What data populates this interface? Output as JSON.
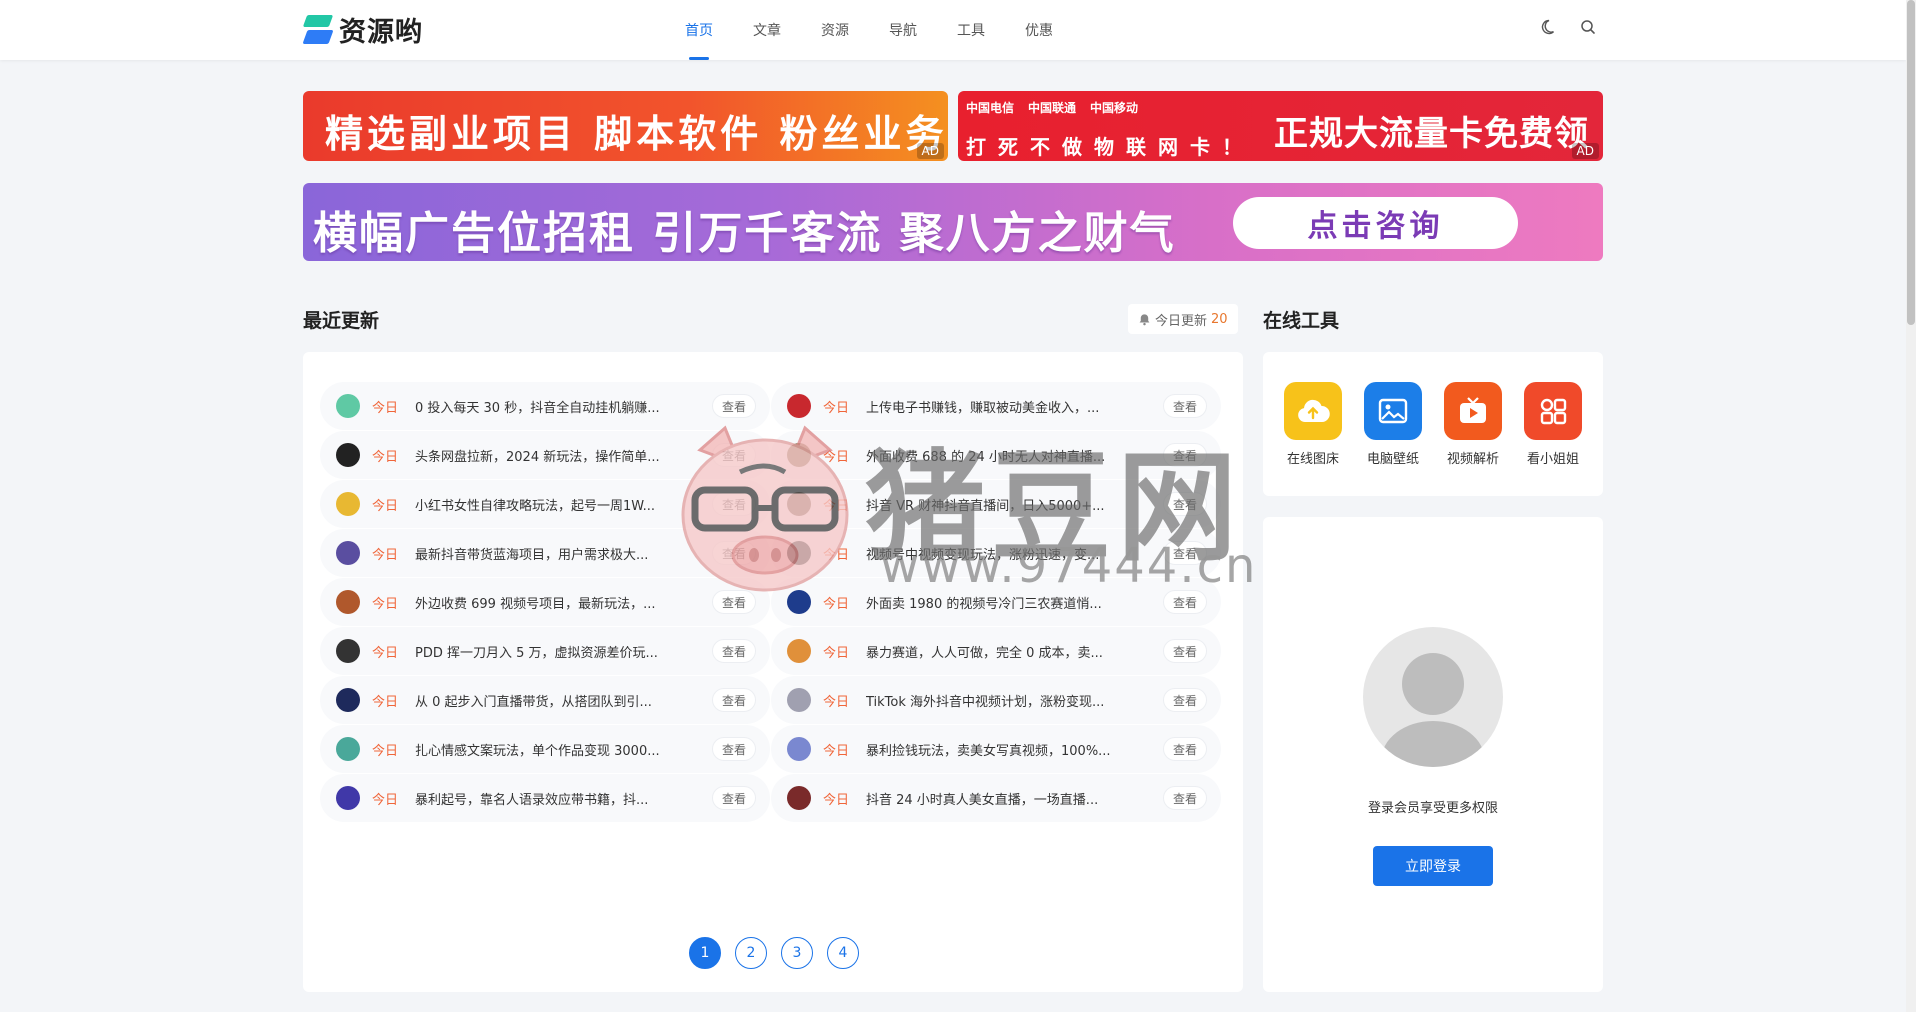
{
  "header": {
    "logo_text": "资源哟",
    "nav": [
      "首页",
      "文章",
      "资源",
      "导航",
      "工具",
      "优惠"
    ],
    "active_nav": 0
  },
  "banners": {
    "b1_text": "精选副业项目 脚本软件 粉丝业务",
    "b2_logos": [
      "中国电信",
      "中国联通",
      "中国移动"
    ],
    "b2_sub": "打死不做物联网卡！",
    "b2_text": "正规大流量卡免费领",
    "ad_tag": "AD",
    "b3_text": "横幅广告位招租 引万千客流 聚八方之财气",
    "b3_cta": "点击咨询"
  },
  "recent": {
    "title": "最近更新",
    "today_label": "今日更新",
    "today_count": "20",
    "tag": "今日",
    "view_label": "查看",
    "left": [
      "0 投入每天 30 秒，抖音全自动挂机躺赚...",
      "头条网盘拉新，2024 新玩法，操作简单...",
      "小红书女性自律攻略玩法，起号一周1W...",
      "最新抖音带货蓝海项目，用户需求极大...",
      "外边收费 699 视频号项目，最新玩法，...",
      "PDD 挥一刀月入 5 万，虚拟资源差价玩...",
      "从 0 起步入门直播带货，从搭团队到引...",
      "扎心情感文案玩法，单个作品变现 3000...",
      "暴利起号，靠名人语录效应带书籍，抖..."
    ],
    "right": [
      "上传电子书赚钱，赚取被动美金收入，...",
      "外面收费 688 的 24 小时无人对神直播...",
      "抖音 VR 财神抖音直播间，日入5000+...",
      "视频号中视频变现玩法，涨粉迅速，变...",
      "外面卖 1980 的视频号冷门三农赛道悄...",
      "暴力赛道，人人可做，完全 0 成本，卖...",
      "TikTok 海外抖音中视频计划，涨粉变现...",
      "暴利捡钱玩法，卖美女写真视频，100%...",
      "抖音 24 小时真人美女直播，一场直播..."
    ],
    "thumb_colors_left": [
      "#5fc9a4",
      "#222222",
      "#e8b832",
      "#5a4ea0",
      "#b0582c",
      "#333333",
      "#1e2a5c",
      "#4aa89a",
      "#4038a8"
    ],
    "thumb_colors_right": [
      "#c8282e",
      "#8a7a5a",
      "#7a6a5a",
      "#2a3a3a",
      "#1e3c8c",
      "#e0903a",
      "#a0a0b0",
      "#7a88d0",
      "#7a2a2a"
    ],
    "pages": [
      "1",
      "2",
      "3",
      "4"
    ],
    "active_page": 0
  },
  "tools": {
    "title": "在线工具",
    "items": [
      {
        "label": "在线图床",
        "icon": "cloud-upload-icon",
        "color": "#f7c21a"
      },
      {
        "label": "电脑壁纸",
        "icon": "image-icon",
        "color": "#1c7ee8"
      },
      {
        "label": "视频解析",
        "icon": "tv-play-icon",
        "color": "#f25a1e"
      },
      {
        "label": "看小姐姐",
        "icon": "apps-icon",
        "color": "#f04a2a"
      }
    ]
  },
  "login": {
    "text": "登录会员享受更多权限",
    "button": "立即登录"
  },
  "watermark": {
    "text": "猪豆网",
    "url": "www.97444.cn"
  }
}
